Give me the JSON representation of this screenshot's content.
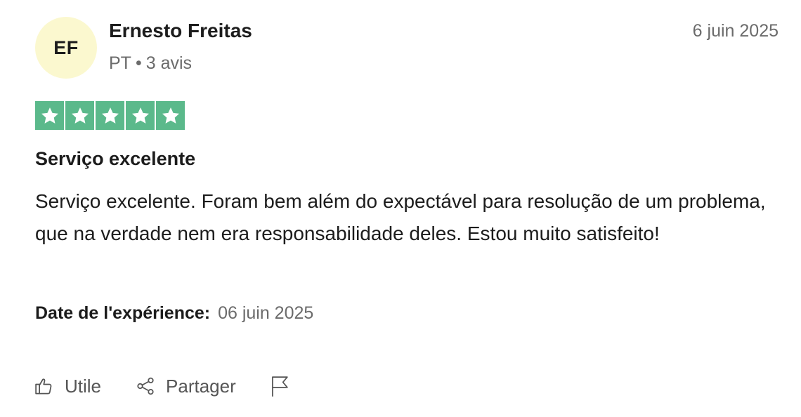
{
  "review": {
    "initials": "EF",
    "author": "Ernesto Freitas",
    "country": "PT",
    "separator": "•",
    "review_count": "3 avis",
    "date": "6 juin 2025",
    "rating": {
      "value": 5,
      "max": 5
    },
    "title": "Serviço excelente",
    "body": "Serviço excelente. Foram bem além do expectável para resolução de um problema, que na verdade nem era responsabilidade deles. Estou muito satisfeito!",
    "experience_label": "Date de l'expérience:",
    "experience_date": "06 juin 2025"
  },
  "actions": {
    "useful_label": "Utile",
    "share_label": "Partager"
  },
  "icons": {
    "useful": "thumbs-up-icon",
    "share": "share-icon",
    "report": "flag-icon",
    "star": "star-icon"
  },
  "colors": {
    "star_green": "#5bb98b",
    "avatar_bg": "#fbf8cf",
    "muted_text": "#6b6b6b"
  }
}
